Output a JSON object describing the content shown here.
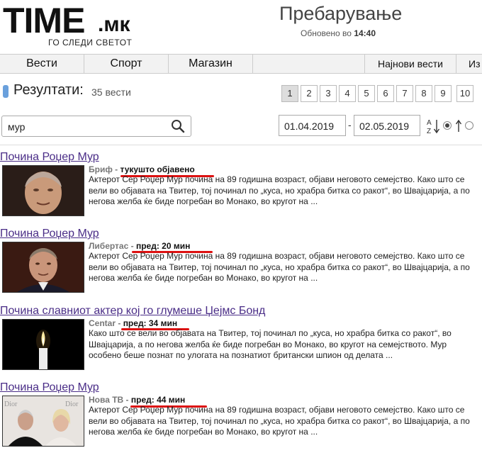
{
  "header": {
    "logo_main": "TIME",
    "logo_domain": ".мк",
    "logo_tagline": "ГО СЛЕДИ СВЕТОТ",
    "page_title": "Пребарување",
    "updated_label": "Обновено во",
    "updated_time": "14:40"
  },
  "nav": {
    "items": [
      "Вести",
      "Спорт",
      "Магазин",
      "Најнови вести",
      "Из"
    ]
  },
  "results": {
    "label": "Резултати:",
    "count": "35 вести",
    "accent_color": "#6aa0dc"
  },
  "pagination": {
    "pages": [
      "1",
      "2",
      "3",
      "4",
      "5",
      "6",
      "7",
      "8",
      "9",
      "10"
    ],
    "current": "1"
  },
  "search": {
    "value": "мур",
    "placeholder": ""
  },
  "filters": {
    "date_from": "01.04.2019",
    "date_sep": "-",
    "date_to": "02.05.2019",
    "sort_icon": "sort-az-icon",
    "radio_selected": "az"
  },
  "articles": [
    {
      "title": "Почина Роџер Мур",
      "source": "Бриф",
      "sep": " - ",
      "time": "тукушто објавено",
      "text": "Актерот Сер Роџер Мур почина на 89 годишна возраст, објави неговото семејство. Како што се вели во објавата на Твитер, тој починал по „куса, но храбра битка со ракот“, во Швајцарија, а по негова желба ќе биде погребан во Монако, во кругот на ..."
    },
    {
      "title": "Почина Роџер Мур",
      "source": "Либертас",
      "sep": " - ",
      "time": "пред: 20 мин",
      "text": "Актерот Сер Роџер Мур почина на 89 годишна возраст, објави неговото семејство. Како што се вели во објавата на Твитер, тој починал по „куса, но храбра битка со ракот“, во Швајцарија, а по негова желба ќе биде погребан во Монако, во кругот на ..."
    },
    {
      "title": "Почина славниот актер кој го глумеше Џејмс Бонд",
      "source": "Centar",
      "sep": " - ",
      "time": "пред: 34 мин",
      "text": "Како што се вели во објавата на Твитер, тој починал по „куса, но храбра битка со ракот“, во Швајцарија, а по негова желба ќе биде погребан во Монако, во кругот на семејството. Мур особено беше познат по улогата на познатиот британски шпион од делата ..."
    },
    {
      "title": "Почина Роџер Мур",
      "source": "Нова ТВ",
      "sep": " - ",
      "time": "пред: 44 мин",
      "text": "Актерот Сер Роџер Мур почина на 89 годишна возраст, објави неговото семејство. Како што се вели во објавата на Твитер, тој починал по „куса, но храбра битка со ракот“, во Швајцарија, а по негова желба ќе биде погребан во Монако, во кругот на ..."
    }
  ],
  "colors": {
    "link": "#4a2d87",
    "highlight": "#d11111",
    "nav_bg": "#f2f2f2"
  }
}
